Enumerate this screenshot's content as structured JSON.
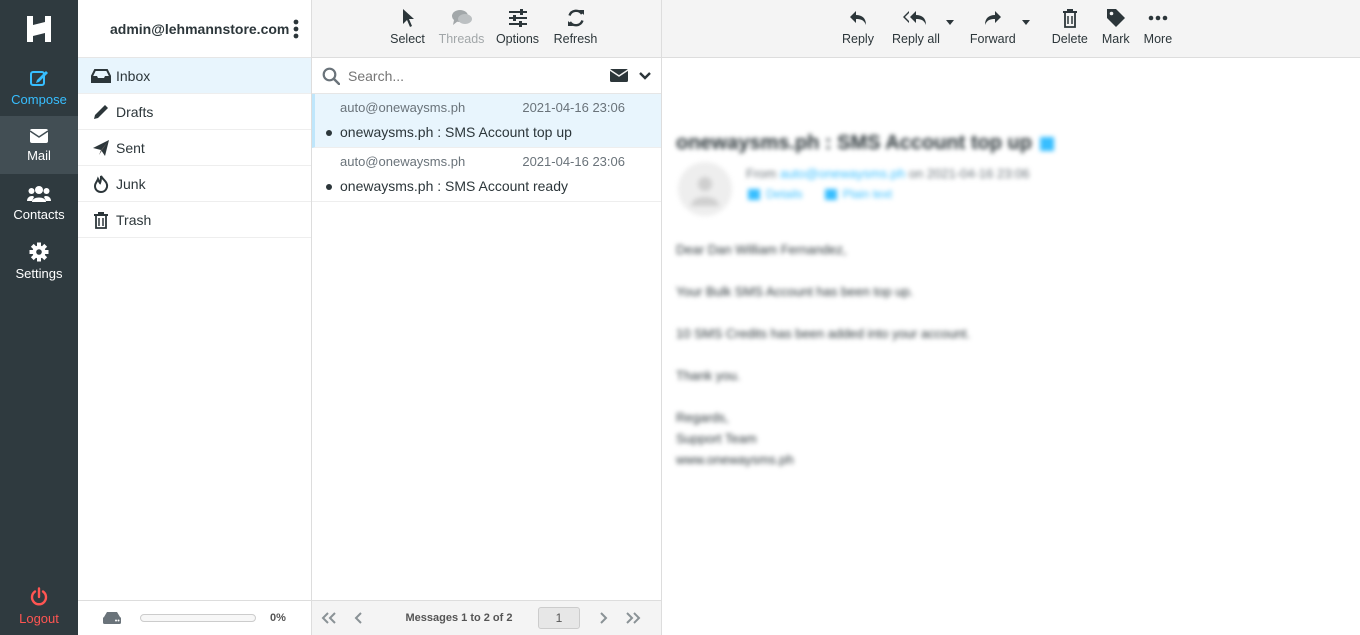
{
  "rail": {
    "compose_label": "Compose",
    "mail_label": "Mail",
    "contacts_label": "Contacts",
    "settings_label": "Settings",
    "logout_label": "Logout"
  },
  "account": {
    "email": "admin@lehmannstore.com"
  },
  "folders": [
    {
      "label": "Inbox",
      "icon": "inbox-icon",
      "active": true
    },
    {
      "label": "Drafts",
      "icon": "pencil-icon",
      "active": false
    },
    {
      "label": "Sent",
      "icon": "paper-plane-icon",
      "active": false
    },
    {
      "label": "Junk",
      "icon": "fire-icon",
      "active": false
    },
    {
      "label": "Trash",
      "icon": "trash-icon",
      "active": false
    }
  ],
  "quota": {
    "percent_text": "0%",
    "fraction": 0
  },
  "list_toolbar": {
    "select_label": "Select",
    "threads_label": "Threads",
    "options_label": "Options",
    "refresh_label": "Refresh"
  },
  "search": {
    "placeholder": "Search..."
  },
  "messages": [
    {
      "from": "auto@onewaysms.ph",
      "date": "2021-04-16 23:06",
      "subject": "onewaysms.ph : SMS Account top up",
      "selected": true
    },
    {
      "from": "auto@onewaysms.ph",
      "date": "2021-04-16 23:06",
      "subject": "onewaysms.ph : SMS Account ready",
      "selected": false
    }
  ],
  "pager": {
    "count_text": "Messages 1 to 2 of 2",
    "page": "1"
  },
  "reader_toolbar": {
    "reply_label": "Reply",
    "reply_all_label": "Reply all",
    "forward_label": "Forward",
    "delete_label": "Delete",
    "mark_label": "Mark",
    "more_label": "More"
  },
  "message_view": {
    "title": "onewaysms.ph : SMS Account top up",
    "from_prefix": "From",
    "from_address": "auto@onewaysms.ph",
    "from_suffix": "on 2021-04-16 23:06",
    "details_label": "Details",
    "plain_text_label": "Plain text",
    "greeting": "Dear Dan William Fernandez,",
    "line1": "Your Bulk SMS Account has been top up.",
    "line2": "10 SMS Credits has been added into your account.",
    "line3": "Thank you.",
    "sign1": "Regards,",
    "sign2": "Support Team",
    "sign3": "www.onewaysms.ph"
  },
  "colors": {
    "rail_bg": "#2f3a3f",
    "accent": "#37beff",
    "logout": "#ff5552",
    "selected_bg": "#e8f5fd"
  }
}
